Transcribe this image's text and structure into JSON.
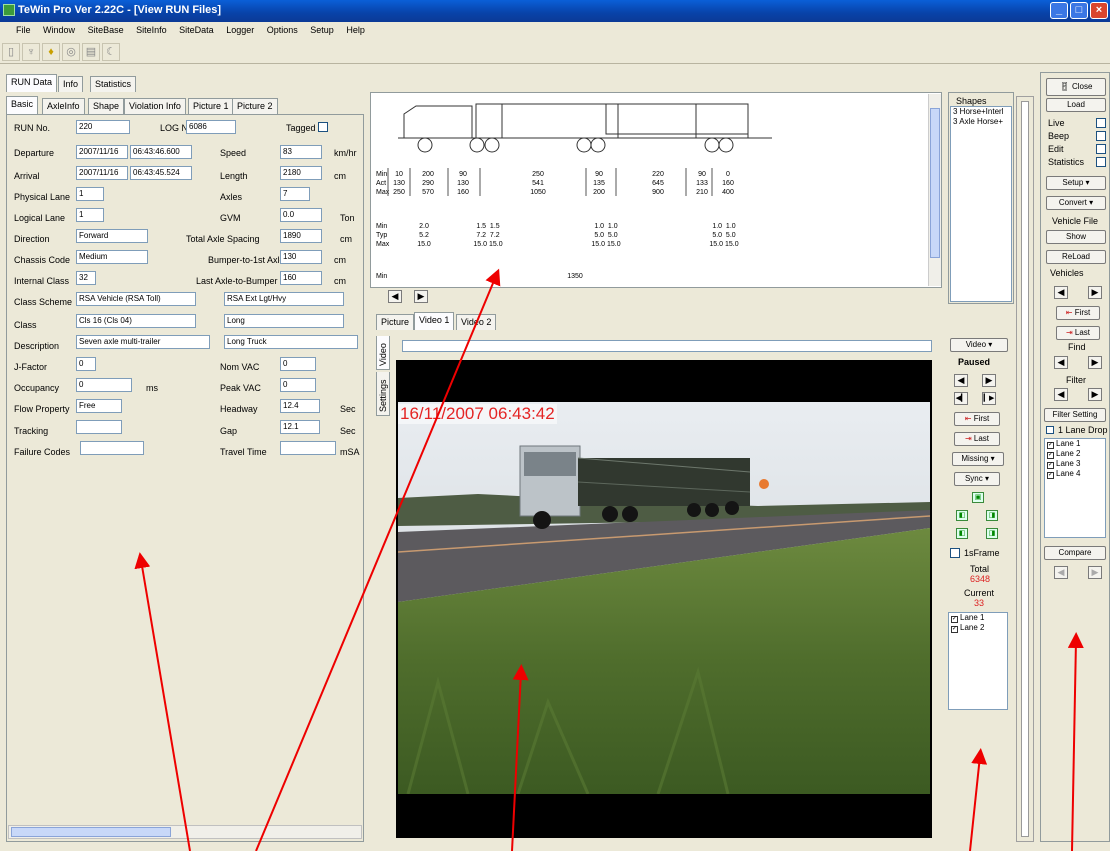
{
  "window": {
    "title": "TeWin Pro Ver 2.22C - [View RUN Files]"
  },
  "menubar": [
    "File",
    "Window",
    "SiteBase",
    "SiteInfo",
    "SiteData",
    "Logger",
    "Options",
    "Setup",
    "Help"
  ],
  "toolbar_icons": [
    "tool-icon-1",
    "tool-icon-2",
    "lightbulb-icon",
    "tool-icon-4",
    "tool-icon-5",
    "moon-icon"
  ],
  "top_tabs": [
    "RUN Data",
    "Info",
    "Statistics"
  ],
  "sub_tabs": [
    "Basic",
    "AxleInfo",
    "Shape",
    "Violation Info",
    "Picture 1",
    "Picture 2"
  ],
  "basic": {
    "run_no_label": "RUN No.",
    "run_no": "220",
    "log_no_label": "LOG No.",
    "log_no": "6086",
    "tagged_label": "Tagged",
    "departure_label": "Departure",
    "departure_date": "2007/11/16",
    "departure_time": "06:43:46.600",
    "speed_label": "Speed",
    "speed": "83",
    "speed_unit": "km/hr",
    "arrival_label": "Arrival",
    "arrival_date": "2007/11/16",
    "arrival_time": "06:43:45.524",
    "length_label": "Length",
    "length": "2180",
    "length_unit": "cm",
    "physical_lane_label": "Physical Lane",
    "physical_lane": "1",
    "axles_label": "Axles",
    "axles": "7",
    "logical_lane_label": "Logical Lane",
    "logical_lane": "1",
    "gvm_label": "GVM",
    "gvm": "0.0",
    "gvm_unit": "Ton",
    "direction_label": "Direction",
    "direction": "Forward",
    "total_axle_spacing_label": "Total Axle Spacing",
    "total_axle_spacing": "1890",
    "total_axle_spacing_unit": "cm",
    "chassis_code_label": "Chassis Code",
    "chassis_code": "Medium",
    "bumper_label": "Bumper-to-1st Axle",
    "bumper": "130",
    "bumper_unit": "cm",
    "internal_class_label": "Internal Class",
    "internal_class": "32",
    "last_axle_label": "Last Axle-to-Bumper",
    "last_axle": "160",
    "last_axle_unit": "cm",
    "class_scheme_label": "Class Scheme",
    "class_scheme": "RSA Vehicle (RSA Toll)",
    "class_scheme2": "RSA Ext Lgt/Hvy",
    "class_label": "Class",
    "class": "Cls 16 (Cls 04)",
    "class2": "Long",
    "description_label": "Description",
    "description": "Seven axle multi-trailer",
    "description2": "Long Truck",
    "jfactor_label": "J-Factor",
    "jfactor": "0",
    "nomvac_label": "Nom VAC",
    "nomvac": "0",
    "occupancy_label": "Occupancy",
    "occupancy": "0",
    "occupancy_unit": "ms",
    "peakvac_label": "Peak VAC",
    "peakvac": "0",
    "flow_label": "Flow Property",
    "flow": "Free",
    "headway_label": "Headway",
    "headway": "12.4",
    "headway_unit": "Sec",
    "tracking_label": "Tracking",
    "gap_label": "Gap",
    "gap": "12.1",
    "gap_unit": "Sec",
    "failure_label": "Failure Codes",
    "travel_label": "Travel Time",
    "travel_unit": "mSA"
  },
  "axle_table": {
    "row_labels_a": [
      "Min",
      "Act",
      "Max"
    ],
    "row_labels_b": [
      "Min",
      "Typ",
      "Max"
    ],
    "row_label_c": "Min",
    "spacing_cols": [
      "10\n130\n250",
      "200\n290\n570",
      "90\n130\n160",
      "250\n541\n1050",
      "90\n135\n200",
      "220\n645\n900",
      "90\n133\n210",
      "0\n160\n400"
    ],
    "load_cols": [
      "2.0\n5.2\n15.0",
      "1.5  1.5\n7.2  7.2\n15.0 15.0",
      "1.0  1.0\n5.0  5.0\n15.0 15.0",
      "1.0  1.0\n5.0  5.0\n15.0 15.0"
    ],
    "bottom_value": "1350"
  },
  "shapes": {
    "header": "Shapes",
    "items": [
      "3 Horse+Interl",
      "3 Axle Horse+"
    ]
  },
  "video_tabs": [
    "Picture",
    "Video 1",
    "Video 2"
  ],
  "side_tabs": [
    "Video",
    "Settings"
  ],
  "video_timestamp": "16/11/2007 06:43:42",
  "video_controls": {
    "video_btn": "Video",
    "status": "Paused",
    "first": "First",
    "last": "Last",
    "missing": "Missing",
    "sync": "Sync",
    "oneframe": "1sFrame",
    "total_label": "Total",
    "total": "6348",
    "current_label": "Current",
    "current": "33",
    "lanes": [
      "Lane 1",
      "Lane 2"
    ]
  },
  "right_panel": {
    "close": "Close",
    "load": "Load",
    "checks": [
      "Live",
      "Beep",
      "Edit",
      "Statistics"
    ],
    "setup": "Setup",
    "convert": "Convert",
    "vehicle_file": "Vehicle File",
    "show": "Show",
    "reload": "ReLoad",
    "vehicles": "Vehicles",
    "first": "First",
    "last": "Last",
    "find": "Find",
    "filter": "Filter",
    "filter_setting": "Filter Setting",
    "lane_drop": "1 Lane Drop",
    "lanes": [
      "Lane 1",
      "Lane 2",
      "Lane 3",
      "Lane 4"
    ],
    "compare": "Compare"
  }
}
